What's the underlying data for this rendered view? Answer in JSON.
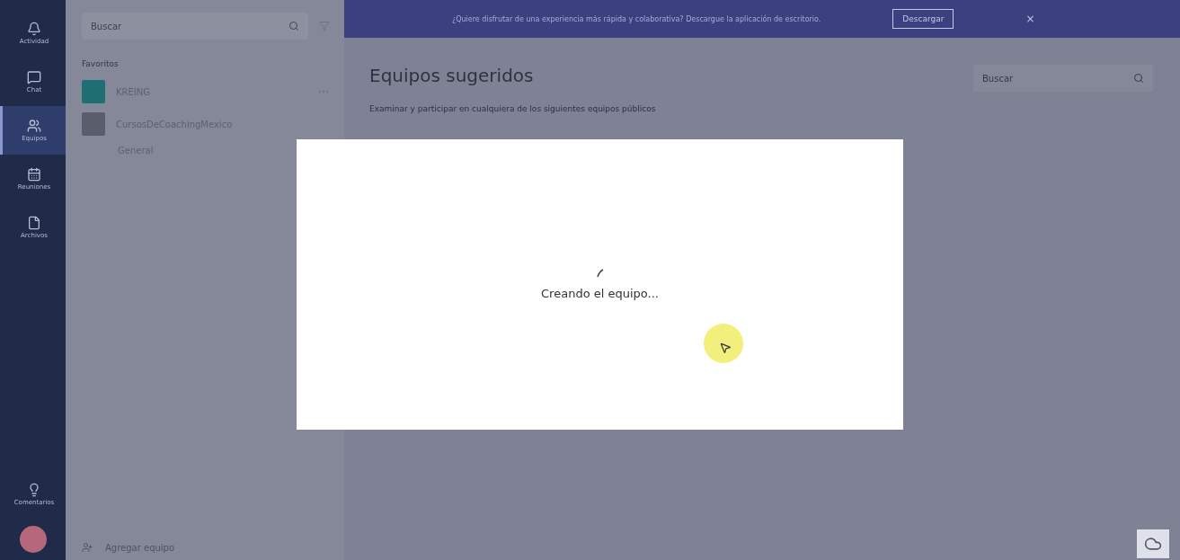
{
  "rail": {
    "items": [
      {
        "label": "Actividad",
        "selected": false
      },
      {
        "label": "Chat",
        "selected": false
      },
      {
        "label": "Equipos",
        "selected": true
      },
      {
        "label": "Reuniones",
        "selected": false
      },
      {
        "label": "Archivos",
        "selected": false
      }
    ],
    "bottom": {
      "label": "Comentarios"
    }
  },
  "sidebar": {
    "search": {
      "placeholder": "Buscar"
    },
    "section": "Favoritos",
    "teams": [
      {
        "name": "KREING",
        "color": "#1f6f72"
      },
      {
        "name": "CursosDeCoachingMexico",
        "color": "#5a5d6c",
        "channels": [
          "General"
        ]
      }
    ],
    "add_label": "Agregar equipo"
  },
  "banner": {
    "text": "¿Quiere disfrutar de una experiencia más rápida y colaborativa? Descargue la aplicación de escritorio.",
    "button": "Descargar",
    "close": "×"
  },
  "main": {
    "title": "Equipos sugeridos",
    "subtitle": "Examinar y participar en cualquiera de los siguientes equipos públicos",
    "search": {
      "placeholder": "Buscar"
    }
  },
  "dialog": {
    "message": "Creando el equipo..."
  }
}
